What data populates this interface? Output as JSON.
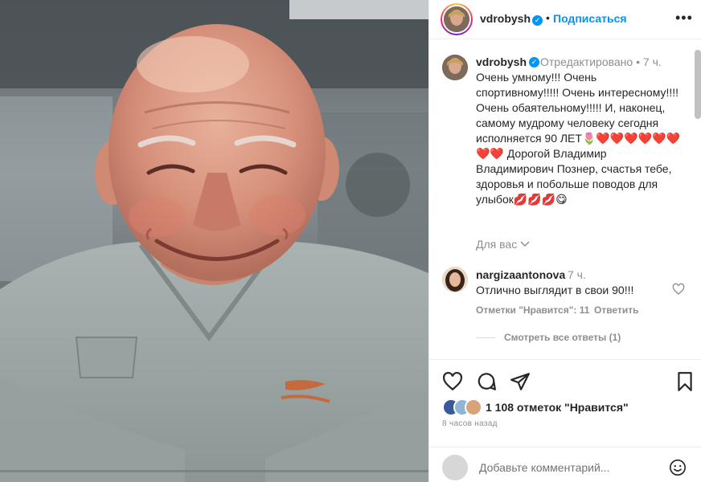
{
  "post": {
    "photo_alt": "smiling elderly man photo",
    "header": {
      "username": "vdrobysh",
      "separator": "•",
      "follow_label": "Подписаться",
      "more_label": "•••"
    },
    "caption": {
      "username": "vdrobysh",
      "edited_label": "Отредактировано",
      "separator": "•",
      "time": "7 ч.",
      "text_part1": "Очень умному!!! Очень спортивному!!!!! Очень интересному!!!! Очень обаятельному!!!!! И, наконец, самому мудрому человеку сегодня исполняется 90 ЛЕТ",
      "tulip_emoji": "🌷",
      "hearts_row": "❤️❤️❤️❤️❤️❤️❤️❤️",
      "text_part2": " Дорогой Владимир Владимирович Познер, счастья тебе, здоровья и побольше поводов для улыбок",
      "lips_emoji": "💋💋💋",
      "wink_emoji": "😋",
      "translate_label": "Для вас"
    },
    "comment": {
      "username": "nargizaantonova",
      "time": "7 ч.",
      "text": "Отлично выглядит в свои 90!!!",
      "likes_label": "Отметки \"Нравится\": 11",
      "reply_label": "Ответить",
      "view_replies_label": "Смотреть все ответы (1)"
    },
    "footer": {
      "likes_text": "1 108 отметок \"Нравится\"",
      "time_ago": "8 часов назад",
      "add_comment_placeholder": "Добавьте комментарий...",
      "liker_colors": [
        "#3b5998",
        "#8fb4d6",
        "#d8a27a"
      ]
    },
    "colors": {
      "accent": "#0095f6",
      "heart_red": "#e0132b",
      "muted": "#8e8e8e"
    }
  }
}
